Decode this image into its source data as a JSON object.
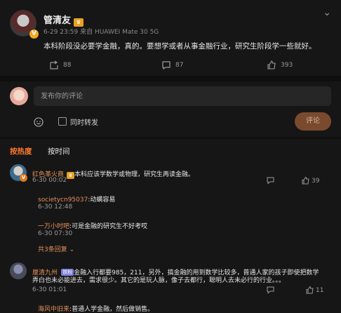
{
  "post": {
    "username": "管清友",
    "meta": "6-29 23:59  来自 HUAWEI Mate 30 5G",
    "text": "本科阶段没必要学金融，真的。要想学或者从事金融行业，研究生阶段学一些就好。",
    "repost_count": "88",
    "comment_count": "87",
    "like_count": "393",
    "more_icon": "chevron-down-icon"
  },
  "composer": {
    "placeholder": "发布你的评论",
    "repost_label": "同时转发",
    "send_label": "评论"
  },
  "sort_tabs": {
    "hot": "按热度",
    "time": "按时间"
  },
  "comments": [
    {
      "name": "红色革火商",
      "text": "本科应该学数学或物理，研究生再读金融。",
      "time": "6-30 00:02",
      "likes": "39",
      "replies": [
        {
          "name": "societycn95037",
          "text": "动螨容易",
          "time": "6-30 12:48"
        },
        {
          "name": "一万小时吧",
          "text": "可是金融的研究生不好考哎",
          "time": "6-30 07:30"
        }
      ],
      "more_replies": "共3条回复"
    },
    {
      "name": "厘清九州",
      "vip": "铁粉",
      "text_line1": "金融入行都要985，211，另外，搞金融的用到数学比较多，普通人家的孩子即使把数学",
      "text_line2": "弄白也未必能进去，需求很少。其它的是玩人脉，像子去都行，聪明人去未必行的行业。。。",
      "time": "6-30 01:01",
      "likes": "11",
      "reply_name": "海风中旧来",
      "reply_text": "普通人学金融，然后做销售。"
    }
  ],
  "colors": {
    "accent": "#ff7a2e",
    "name_color": "#e6915a",
    "send_button": "#7a4a2f",
    "background": "#161616"
  }
}
